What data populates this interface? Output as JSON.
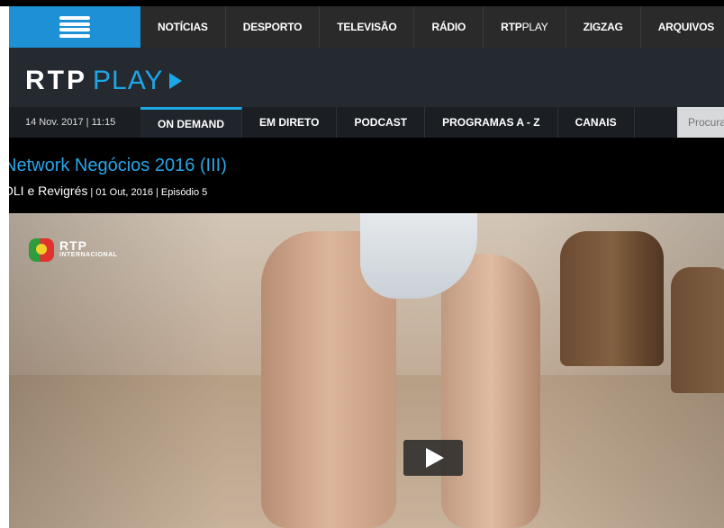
{
  "top_nav": {
    "items": [
      "NOTÍCIAS",
      "DESPORTO",
      "TELEVISÃO",
      "RÁDIO",
      "RTP",
      "ZIGZAG",
      "ARQUIVOS"
    ],
    "rtpplay_suffix": "PLAY"
  },
  "brand": {
    "rtp": "RTP",
    "play": "PLAY"
  },
  "sub_nav": {
    "date": "14 Nov. 2017 | 11:15",
    "items": [
      "ON DEMAND",
      "EM DIRETO",
      "PODCAST",
      "PROGRAMAS A - Z",
      "CANAIS"
    ],
    "active": "ON DEMAND",
    "search_placeholder": "Procurar"
  },
  "episode": {
    "title": "Network Negócios 2016 (III)",
    "subject": "OLI e Revigrés",
    "details": " | 01 Out, 2016 | Episódio 5"
  },
  "video": {
    "channel_logo": {
      "name": "RTP",
      "sub": "INTERNACIONAL",
      "icon": "rtp-flag-icon"
    },
    "play_icon": "play-icon"
  },
  "colors": {
    "accent": "#1da6e8",
    "menu_blue": "#1e90d6"
  }
}
